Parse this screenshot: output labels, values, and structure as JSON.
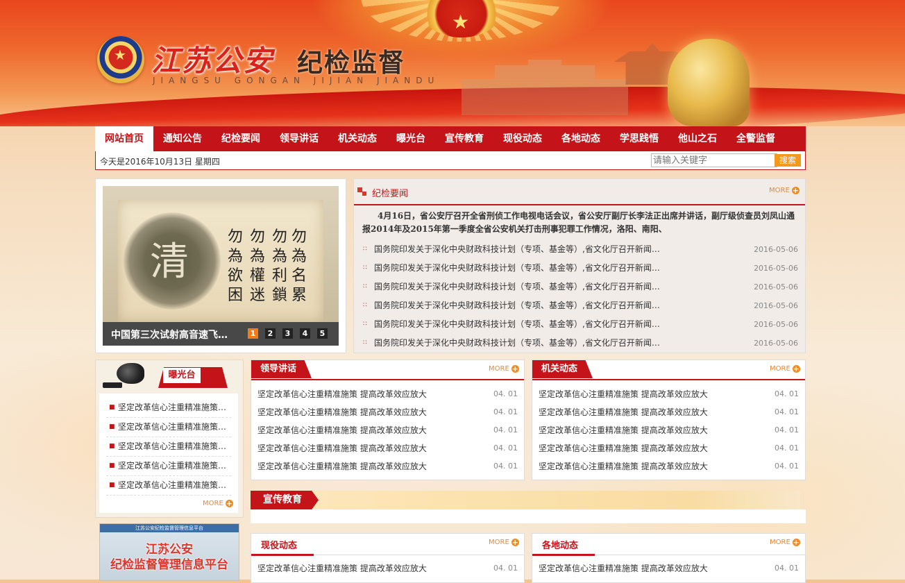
{
  "header": {
    "logo_cn": "江苏公安",
    "logo_cn2": "纪检监督",
    "logo_en": "JIANGSU GONGAN JIJIAN JIANDU"
  },
  "nav": {
    "items": [
      "网站首页",
      "通知公告",
      "纪检要闻",
      "领导讲话",
      "机关动态",
      "曝光台",
      "宣传教育",
      "现役动态",
      "各地动态",
      "学思践悟",
      "他山之石",
      "全警监督"
    ],
    "active": "网站首页"
  },
  "datebar": {
    "date": "今天是2016年10月13日  星期四",
    "search_placeholder": "请输入关键字",
    "search_button": "搜索"
  },
  "slider": {
    "image_char": "清",
    "verse_cols": [
      "勿為名累",
      "勿為利鎖",
      "勿為權迷",
      "勿為欲困"
    ],
    "caption": "中国第三次试射高音速飞…",
    "dots": [
      "1",
      "2",
      "3",
      "4",
      "5"
    ],
    "active_dot": "1"
  },
  "more_label": "MORE",
  "jijian": {
    "title": "纪检要闻",
    "headline": "4月16日，省公安厅召开全省刑侦工作电视电话会议，省公安厅副厅长李法正出席并讲话，副厅级侦查员刘凤山通报2014年及2015年第一季度全省公安机关打击刑事犯罪工作情况，洛阳、南阳、",
    "items": [
      {
        "title": "国务院印发关于深化中央财政科技计划（专项、基金等）,省文化厅召开新闻…",
        "date": "2016-05-06"
      },
      {
        "title": "国务院印发关于深化中央财政科技计划（专项、基金等）,省文化厅召开新闻…",
        "date": "2016-05-06"
      },
      {
        "title": "国务院印发关于深化中央财政科技计划（专项、基金等）,省文化厅召开新闻…",
        "date": "2016-05-06"
      },
      {
        "title": "国务院印发关于深化中央财政科技计划（专项、基金等）,省文化厅召开新闻…",
        "date": "2016-05-06"
      },
      {
        "title": "国务院印发关于深化中央财政科技计划（专项、基金等）,省文化厅召开新闻…",
        "date": "2016-05-06"
      },
      {
        "title": "国务院印发关于深化中央财政科技计划（专项、基金等）,省文化厅召开新闻…",
        "date": "2016-05-06"
      }
    ]
  },
  "exposure": {
    "title": "曝光台",
    "items": [
      "坚定改革信心注重精准施策…",
      "坚定改革信心注重精准施策…",
      "坚定改革信心注重精准施策…",
      "坚定改革信心注重精准施策…",
      "坚定改革信心注重精准施策…"
    ]
  },
  "platform": {
    "bar": "江苏公安纪检监督管理信息平台",
    "line1": "江苏公安",
    "line2": "纪检监督管理信息平台"
  },
  "leader": {
    "title": "领导讲话",
    "items": [
      {
        "title": "坚定改革信心注重精准施策 提高改革效应放大",
        "date": "04. 01"
      },
      {
        "title": "坚定改革信心注重精准施策 提高改革效应放大",
        "date": "04. 01"
      },
      {
        "title": "坚定改革信心注重精准施策 提高改革效应放大",
        "date": "04. 01"
      },
      {
        "title": "坚定改革信心注重精准施策 提高改革效应放大",
        "date": "04. 01"
      },
      {
        "title": "坚定改革信心注重精准施策 提高改革效应放大",
        "date": "04. 01"
      }
    ]
  },
  "organ": {
    "title": "机关动态",
    "items": [
      {
        "title": "坚定改革信心注重精准施策 提高改革效应放大",
        "date": "04. 01"
      },
      {
        "title": "坚定改革信心注重精准施策 提高改革效应放大",
        "date": "04. 01"
      },
      {
        "title": "坚定改革信心注重精准施策 提高改革效应放大",
        "date": "04. 01"
      },
      {
        "title": "坚定改革信心注重精准施策 提高改革效应放大",
        "date": "04. 01"
      },
      {
        "title": "坚定改革信心注重精准施策 提高改革效应放大",
        "date": "04. 01"
      }
    ]
  },
  "xuanchuan": {
    "title": "宣传教育"
  },
  "active_duty": {
    "title": "现役动态",
    "items": [
      {
        "title": "坚定改革信心注重精准施策 提高改革效应放大",
        "date": "04. 01"
      }
    ]
  },
  "local": {
    "title": "各地动态",
    "items": [
      {
        "title": "坚定改革信心注重精准施策 提高改革效应放大",
        "date": "04. 01"
      }
    ]
  },
  "colors": {
    "brand_red": "#c4141a",
    "accent_orange": "#f39a1e"
  }
}
